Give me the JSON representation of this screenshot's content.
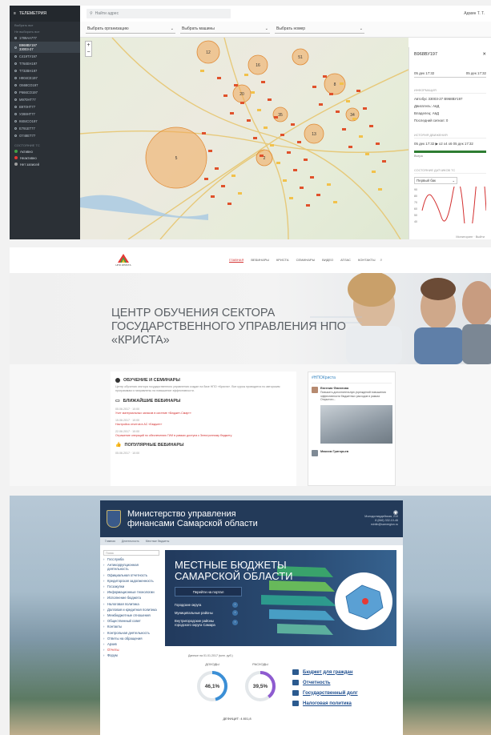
{
  "telemetry": {
    "menu_title": "ТЕЛЕМЕТРИЯ",
    "search_placeholder": "Найти адрес",
    "user": "Админ Т. Т.",
    "sidebar_hints": [
      "Выбрать все",
      "Не выбирать все"
    ],
    "vehicles": [
      {
        "id": "1789AA777",
        "sub": ""
      },
      {
        "id": "В968ВУ197",
        "sub": "33003-27",
        "selected": true
      },
      {
        "id": "С419ТУ197",
        "sub": ""
      },
      {
        "id": "Т764ЕН197",
        "sub": ""
      },
      {
        "id": "Т732ВН197",
        "sub": ""
      },
      {
        "id": "Н904СЕ197",
        "sub": ""
      },
      {
        "id": "О668СО197",
        "sub": ""
      },
      {
        "id": "Р666СО197",
        "sub": ""
      },
      {
        "id": "М970НТ77",
        "sub": ""
      },
      {
        "id": "В970НТ77",
        "sub": ""
      },
      {
        "id": "У288НТ77",
        "sub": ""
      },
      {
        "id": "К604СО197",
        "sub": ""
      },
      {
        "id": "Е791ЕТ77",
        "sub": ""
      },
      {
        "id": "О748ЕТ77",
        "sub": ""
      }
    ],
    "status_title": "СОСТОЯНИЕ ТС",
    "statuses": [
      {
        "label": "Активно",
        "color": "#43a047"
      },
      {
        "label": "Неактивно",
        "color": "#e53935"
      },
      {
        "label": "Нет записей",
        "color": "#9e9e9e"
      }
    ],
    "filters": [
      "Выбрать организацию",
      "Выбрать машины",
      "Выбрать номер"
    ],
    "map_counts": [
      "12",
      "16",
      "51",
      "8",
      "20",
      "35",
      "13",
      "34",
      "5",
      "2"
    ],
    "panel": {
      "vehicle": "В968ВУ197",
      "date_from": "05 дек 17:32",
      "date_to": "05 дек 17:32",
      "info_title": "ИНФОРМАЦИЯ",
      "info_rows": [
        "Автобус 33003-27 В968ВУ197",
        "Двигатель: АвД",
        "Владелец: АвД",
        "Последний сигнал: 0"
      ],
      "history_title": "ИСТОРИЯ ДВИЖЕНИЯ",
      "history_range": "05 дек 17:32 ▶ x2 x4 x6 05 дек 17:32",
      "track_label": "Вчера",
      "sensor_title": "СОСТОЯНИЕ ДАТЧИКОВ ТС",
      "sensor_select": "Первый бак",
      "chart_ticks": [
        "90",
        "80",
        "70",
        "60",
        "50",
        "40"
      ]
    },
    "footer": "Мониторинг · Выйти"
  },
  "krista": {
    "logo_text": "НПО КРИСТА",
    "nav": [
      "Главная",
      "Вебинары",
      "Криста",
      "Семинары",
      "Видео",
      "Атлас",
      "Контакты"
    ],
    "hero_title": "ЦЕНТР ОБУЧЕНИЯ СЕКТОРА ГОСУДАРСТВЕННОГО УПРАВЛЕНИЯ НПО «КРИСТА»",
    "section1": "ОБУЧЕНИЕ И СЕМИНАРЫ",
    "section1_text": "Центр обучения сектора государственного управления создан на базе НПО «Криста». Все курсы проводятся по авторским программам и направлены на повышение эффективности.",
    "section2": "БЛИЖАЙШИЕ ВЕБИНАРЫ",
    "webinars": [
      {
        "date": "05.06.2017 · 10:00",
        "title": "Учет материальных запасов в системе «Бюджет-Смарт»"
      },
      {
        "date": "15.06.2017 · 10:00",
        "title": "Настройка отчетов в АС «Бюджет»"
      },
      {
        "date": "22.06.2017 · 10:00",
        "title": "Отражение операций по обеспечению ГИИ в рамках доступа к Электронному бюджету"
      }
    ],
    "section3": "ПОПУЛЯРНЫЕ ВЕБИНАРЫ",
    "popular_date": "05.06.2017 · 10:00",
    "twitter_title": "#НПОКриста",
    "tw_user1": "Евгения Филатова",
    "tw_text1": "Повысить дополнительную учреждений повышения эффективности бюджетных расходов в рамках Открытого...",
    "tw_user2": "Максим Григорьев"
  },
  "samara": {
    "title_line1": "Министерство управления",
    "title_line2": "финансами Самарской области",
    "contacts": [
      "Молодогвардейская, 210",
      "8 (846) 332-10-46",
      "minfin@samregion.ru"
    ],
    "breadcrumbs": [
      "Главная",
      "Деятельность",
      "Местные бюджеты"
    ],
    "search_placeholder": "Поиск",
    "menu": [
      "Госслужба",
      "Антикоррупционная деятельность",
      "Официальная отчетность",
      "Кредиторская задолженность",
      "Госзакупки",
      "Информационные технологии",
      "Исполнение бюджета",
      "Налоговая политика",
      "Долговая и кредитная политика",
      "Межбюджетные отношения",
      "Общественный совет",
      "Контакты",
      "Контрольная деятельность",
      "Ответы на обращения",
      "Архив",
      "Отчеты",
      "Форум"
    ],
    "menu_active": "Отчеты",
    "banner_title_1": "МЕСТНЫЕ БЮДЖЕТЫ",
    "banner_title_2": "САМАРСКОЙ ОБЛАСТИ",
    "banner_button": "Перейти на портал",
    "banner_list": [
      "Городские округа",
      "Муниципальные районы",
      "Внутригородские районы городского округа Самара"
    ],
    "stats_caption": "Данные на 01.01.2017 (млн. руб.)",
    "income_label": "ДОХОДЫ",
    "expense_label": "РАСХОДЫ",
    "income_pct": "46,1%",
    "income_fraction": 0.461,
    "expense_pct": "39,5%",
    "expense_fraction": 0.395,
    "deficit": "ДЕФИЦИТ: 4 801,8",
    "links": [
      "Бюджет для граждан",
      "Отчетность",
      "Государственный долг",
      "Налоговая политика"
    ]
  }
}
